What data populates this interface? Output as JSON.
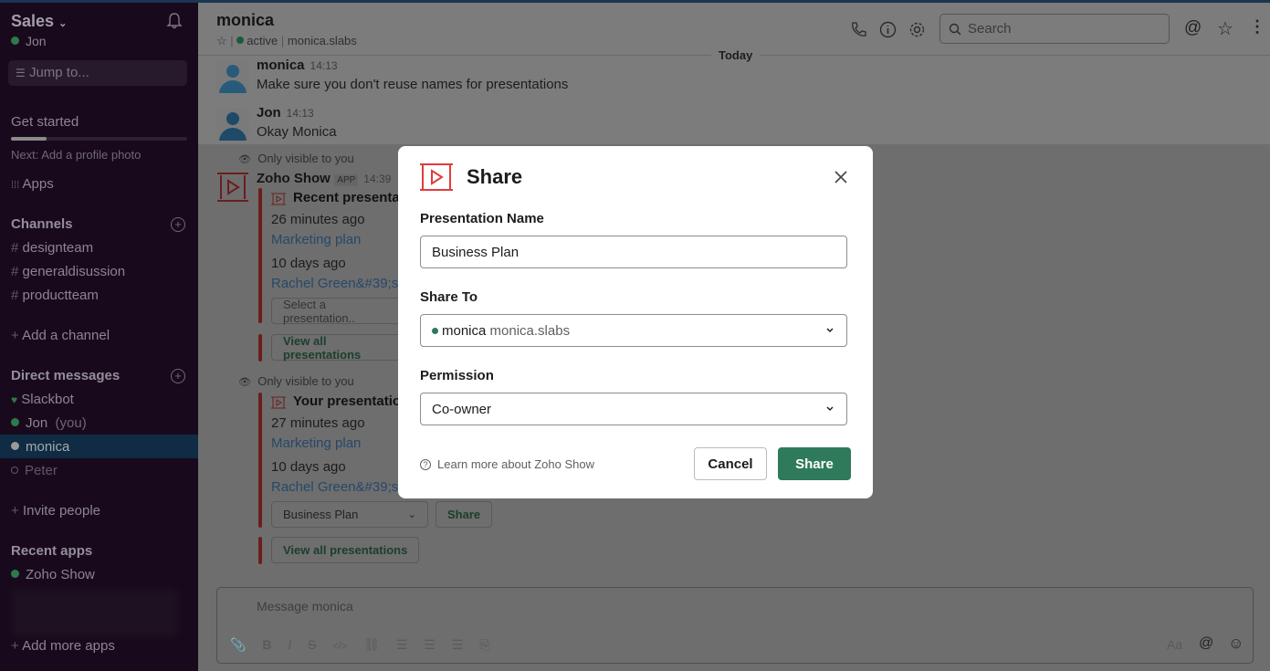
{
  "workspace": {
    "name": "Sales",
    "user": "Jon"
  },
  "sidebar": {
    "jump_placeholder": "Jump to...",
    "get_started": "Get started",
    "progress": 0.2,
    "next": "Next: Add a profile photo",
    "apps": "Apps",
    "channels_header": "Channels",
    "channels": [
      "designteam",
      "generaldisussion",
      "productteam"
    ],
    "add_channel": "Add a channel",
    "dm_header": "Direct messages",
    "dms": [
      {
        "name": "Slackbot"
      },
      {
        "name": "Jon",
        "suffix": "(you)"
      },
      {
        "name": "monica"
      },
      {
        "name": "Peter"
      }
    ],
    "invite": "Invite people",
    "recent_apps_header": "Recent apps",
    "recent_apps": [
      "Zoho Show"
    ],
    "add_apps": "Add more apps"
  },
  "header": {
    "title": "monica",
    "status": "active",
    "handle": "monica.slabs",
    "search_placeholder": "Search"
  },
  "messages": {
    "day": "Today",
    "m1": {
      "name": "monica",
      "time": "14:13",
      "text": "Make sure you don't reuse names for presentations"
    },
    "m2": {
      "name": "Jon",
      "time": "14:13",
      "text": "Okay Monica"
    },
    "only_visible": "Only visible to you",
    "app": {
      "name": "Zoho Show",
      "badge": "APP",
      "time": "14:39"
    },
    "b1": {
      "title": "Recent presentat",
      "t1": "26 minutes ago",
      "l1": "Marketing plan",
      "t2": "10 days ago",
      "l2": "Rachel Green&#39;s",
      "select": "Select a presentation..",
      "view_all": "View all presentations"
    },
    "b2": {
      "title": "Your presentation",
      "t1": "27 minutes ago",
      "l1": "Marketing plan",
      "t2": "10 days ago",
      "l2": "Rachel Green&#39;s",
      "select": "Business Plan",
      "share": "Share",
      "view_all": "View all presentations"
    }
  },
  "composer": {
    "placeholder": "Message monica",
    "aa": "Aa"
  },
  "modal": {
    "title": "Share",
    "name_label": "Presentation Name",
    "name_value": "Business Plan",
    "share_to_label": "Share To",
    "share_to_name": "monica",
    "share_to_handle": "monica.slabs",
    "permission_label": "Permission",
    "permission_value": "Co-owner",
    "learn_more": "Learn more about Zoho Show",
    "cancel": "Cancel",
    "share": "Share",
    "accent": "#2e7a5a",
    "brand": "#e03c3c"
  }
}
